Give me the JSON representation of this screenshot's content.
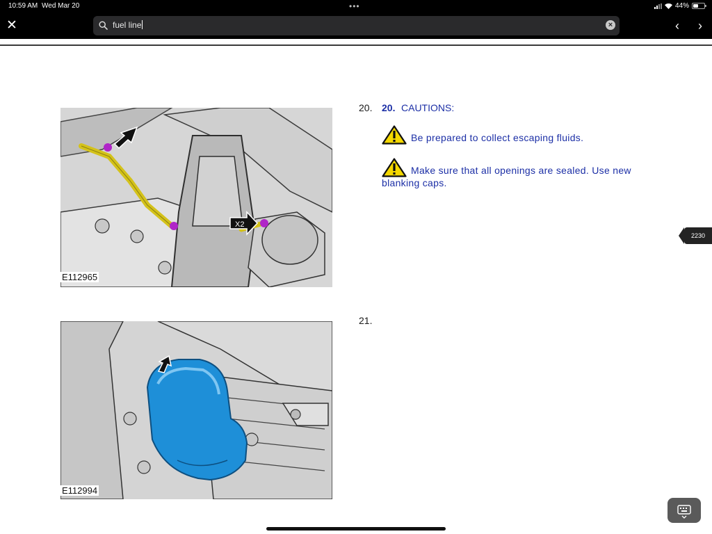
{
  "status_bar": {
    "time": "10:59 AM",
    "date": "Wed Mar 20",
    "battery_percent": "44%",
    "battery_level": 0.44
  },
  "toolbar": {
    "search_query": "fuel line"
  },
  "document": {
    "page_number": "2230",
    "steps": [
      {
        "number": "20.",
        "inline_number": "20.",
        "title": "CAUTIONS:",
        "figure_label": "E112965",
        "callout": "X2",
        "cautions": [
          "Be prepared to collect escaping fluids.",
          "Make sure that all openings are sealed. Use new blanking caps."
        ]
      },
      {
        "number": "21.",
        "figure_label": "E112994"
      }
    ]
  },
  "colors": {
    "link_blue": "#1c2fa6",
    "caution_yellow": "#f5d800",
    "fuel_line_yellow": "#d4c21a",
    "blanking_cap_blue": "#1e8fd8",
    "marker_purple": "#b025c8"
  },
  "icons": {
    "close": "close-icon",
    "search": "search-icon",
    "clear": "clear-icon",
    "previous": "chevron-left-icon",
    "next": "chevron-right-icon",
    "warning": "warning-triangle-icon",
    "keyboard": "keyboard-icon"
  }
}
